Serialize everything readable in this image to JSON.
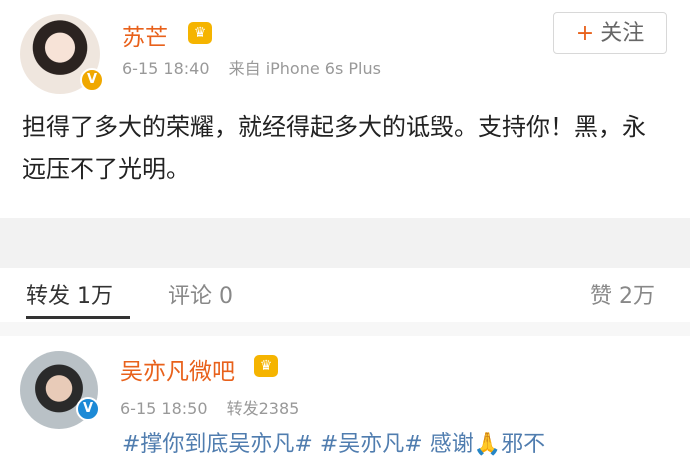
{
  "post": {
    "author": "苏芒",
    "time": "6-15 18:40",
    "source": "来自 iPhone 6s Plus",
    "follow_label": "关注",
    "follow_icon": "plus-icon",
    "content": "担得了多大的荣耀，就经得起多大的诋毁。支持你！黑，永远压不了光明。",
    "badge": "V",
    "badge_color": "#f0a800",
    "name_color": "#e8611b"
  },
  "tabs": {
    "repost": "转发 1万",
    "comment": "评论 0",
    "like": "赞 2万"
  },
  "repost_item": {
    "author": "吴亦凡微吧",
    "time": "6-15 18:50",
    "count": "转发2385",
    "badge": "V",
    "badge_color": "#1d8ad6",
    "text": "#撑你到底吴亦凡# #吴亦凡# 感谢🙏邪不"
  }
}
